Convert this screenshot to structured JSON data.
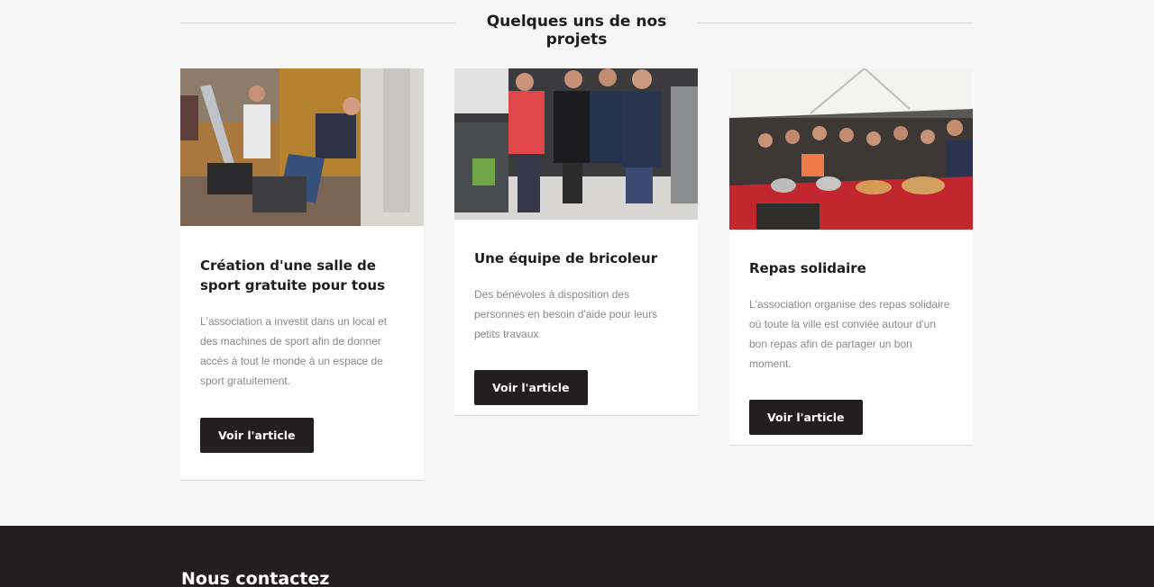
{
  "section": {
    "title": "Quelques uns de nos projets"
  },
  "projects": [
    {
      "title": "Création d'une salle de sport gratuite pour tous",
      "description": "L'association a investit dans un local et des machines de sport afin de donner accès à tout le monde à un espace de sport gratuitement.",
      "button_label": "Voir l'article",
      "image_icon": "gym-photo"
    },
    {
      "title": "Une équipe de bricoleur",
      "description": "Des bénévoles à disposition des personnes en besoin d'aide pour leurs petits travaux",
      "button_label": "Voir l'article",
      "image_icon": "workshop-team-photo"
    },
    {
      "title": "Repas solidaire",
      "description": "L'association organise des repas solidaire où toute la ville est conviée autour d'un bon repas afin de partager un bon moment.",
      "button_label": "Voir l'article",
      "image_icon": "community-meal-photo"
    }
  ],
  "footer": {
    "contact_title": "Nous contactez"
  },
  "colors": {
    "background": "#f6f6f6",
    "card": "#ffffff",
    "button": "#231f20",
    "footer": "#231f20",
    "heading": "#1f1c1d",
    "body_text": "#8a8a8a"
  }
}
